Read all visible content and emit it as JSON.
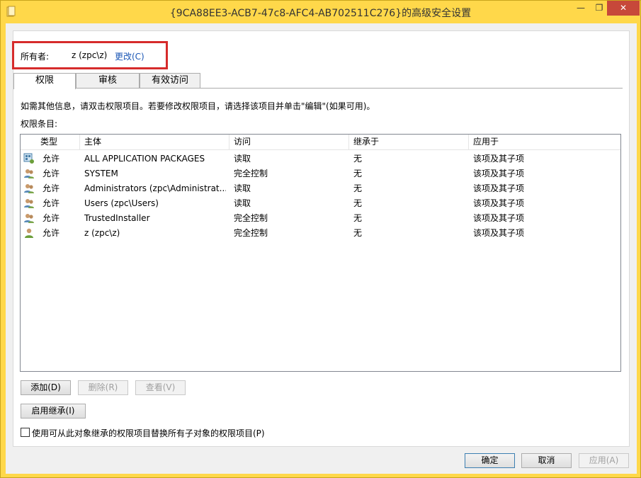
{
  "window": {
    "title": "{9CA88EE3-ACB7-47c8-AFC4-AB702511C276}的高级安全设置",
    "minimize_glyph": "—",
    "maximize_glyph": "❐",
    "close_glyph": "✕"
  },
  "owner": {
    "label": "所有者:",
    "value": "z (zpc\\z)",
    "change_link": "更改(C)"
  },
  "tabs": [
    {
      "label": "权限",
      "active": true
    },
    {
      "label": "审核",
      "active": false
    },
    {
      "label": "有效访问",
      "active": false
    }
  ],
  "info_text": "如需其他信息，请双击权限项目。若要修改权限项目，请选择该项目并单击\"编辑\"(如果可用)。",
  "entries_label": "权限条目:",
  "table": {
    "columns": [
      "类型",
      "主体",
      "访问",
      "继承于",
      "应用于"
    ],
    "rows": [
      {
        "icon": "app-packages-icon",
        "type": "允许",
        "principal": "ALL APPLICATION PACKAGES",
        "access": "读取",
        "inherited": "无",
        "applies": "该项及其子项"
      },
      {
        "icon": "group-icon",
        "type": "允许",
        "principal": "SYSTEM",
        "access": "完全控制",
        "inherited": "无",
        "applies": "该项及其子项"
      },
      {
        "icon": "group-icon",
        "type": "允许",
        "principal": "Administrators (zpc\\Administrat...",
        "access": "读取",
        "inherited": "无",
        "applies": "该项及其子项"
      },
      {
        "icon": "group-icon",
        "type": "允许",
        "principal": "Users (zpc\\Users)",
        "access": "读取",
        "inherited": "无",
        "applies": "该项及其子项"
      },
      {
        "icon": "group-icon",
        "type": "允许",
        "principal": "TrustedInstaller",
        "access": "完全控制",
        "inherited": "无",
        "applies": "该项及其子项"
      },
      {
        "icon": "user-icon",
        "type": "允许",
        "principal": "z (zpc\\z)",
        "access": "完全控制",
        "inherited": "无",
        "applies": "该项及其子项"
      }
    ]
  },
  "buttons": {
    "add": "添加(D)",
    "remove": "删除(R)",
    "view": "查看(V)",
    "enable_inheritance": "启用继承(I)",
    "ok": "确定",
    "cancel": "取消",
    "apply": "应用(A)"
  },
  "replace_checkbox": {
    "label": "使用可从此对象继承的权限项目替换所有子对象的权限项目(P)",
    "checked": false
  },
  "colors": {
    "titlebar": "#ffd84a",
    "close_button": "#c7483a",
    "highlight_box": "#d62b2b",
    "link": "#1a56b5"
  }
}
